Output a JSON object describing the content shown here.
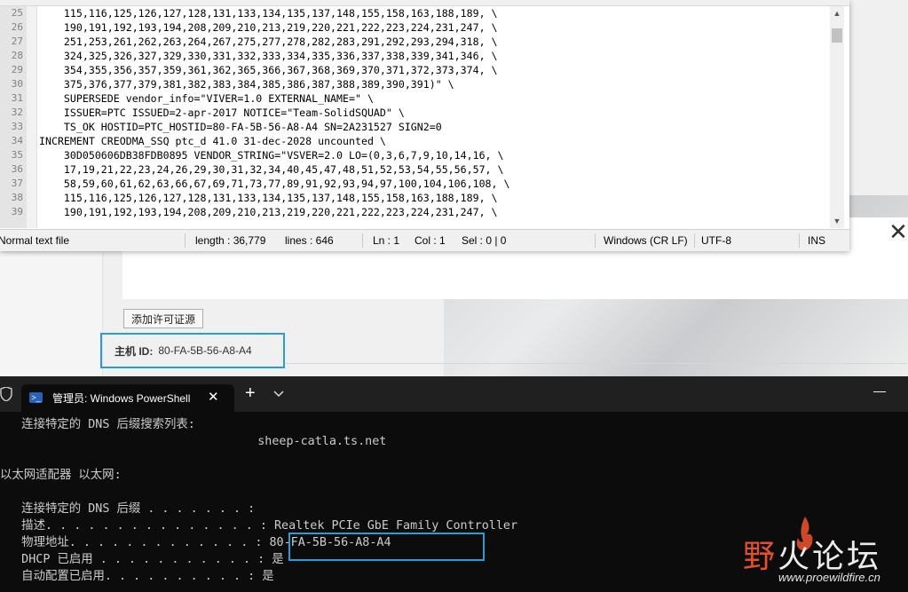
{
  "background_dialog": {
    "add_license_button": "添加许可证源",
    "host_id_label": "主机 ID:",
    "host_id_value": "80-FA-5B-56-A8-A4"
  },
  "notepad": {
    "line_numbers": [
      "25",
      "26",
      "27",
      "28",
      "29",
      "30",
      "31",
      "32",
      "33",
      "34",
      "35",
      "36",
      "37",
      "38",
      "39"
    ],
    "lines": [
      "    115,116,125,126,127,128,131,133,134,135,137,148,155,158,163,188,189, \\",
      "    190,191,192,193,194,208,209,210,213,219,220,221,222,223,224,231,247, \\",
      "    251,253,261,262,263,264,267,275,277,278,282,283,291,292,293,294,318, \\",
      "    324,325,326,327,329,330,331,332,333,334,335,336,337,338,339,341,346, \\",
      "    354,355,356,357,359,361,362,365,366,367,368,369,370,371,372,373,374, \\",
      "    375,376,377,379,381,382,383,384,385,386,387,388,389,390,391)\" \\",
      "    SUPERSEDE vendor_info=\"VIVER=1.0 EXTERNAL_NAME=\" \\",
      "    ISSUER=PTC ISSUED=2-apr-2017 NOTICE=\"Team-SolidSQUAD\" \\",
      "    TS_OK HOSTID=PTC_HOSTID=80-FA-5B-56-A8-A4 SN=2A231527 SIGN2=0",
      "INCREMENT CREODMA_SSQ ptc_d 41.0 31-dec-2028 uncounted \\",
      "    30D050606DB38FDB0895 VENDOR_STRING=\"VSVER=2.0 LO=(0,3,6,7,9,10,14,16, \\",
      "    17,19,21,22,23,24,26,29,30,31,32,34,40,45,47,48,51,52,53,54,55,56,57, \\",
      "    58,59,60,61,62,63,66,67,69,71,73,77,89,91,92,93,94,97,100,104,106,108, \\",
      "    115,116,125,126,127,128,131,133,134,135,137,148,155,158,163,188,189, \\",
      "    190,191,192,193,194,208,209,210,213,219,220,221,222,223,224,231,247, \\"
    ],
    "status": {
      "file_type": "Normal text file",
      "length": "length : 36,779",
      "lines": "lines : 646",
      "ln": "Ln : 1",
      "col": "Col : 1",
      "sel": "Sel : 0 | 0",
      "eol": "Windows (CR LF)",
      "encoding": "UTF-8",
      "mode": "INS"
    }
  },
  "powershell": {
    "tab_title": "管理员: Windows PowerShell",
    "lines": [
      "   连接特定的 DNS 后缀搜索列表:",
      "                                    sheep-catla.ts.net",
      "",
      "以太网适配器 以太网:",
      "",
      "   连接特定的 DNS 后缀 . . . . . . . :",
      "   描述. . . . . . . . . . . . . . . : Realtek PCIe GbE Family Controller",
      "   物理地址. . . . . . . . . . . . . : 80-FA-5B-56-A8-A4",
      "   DHCP 已启用 . . . . . . . . . . . : 是",
      "   自动配置已启用. . . . . . . . . . : 是"
    ]
  },
  "watermark": {
    "text": "野火论坛",
    "url": "www.proewildfire.cn"
  },
  "colors": {
    "highlight": "#2b9bd8",
    "terminal_bg": "#0c0c0c",
    "watermark_accent": "#e2502c"
  }
}
